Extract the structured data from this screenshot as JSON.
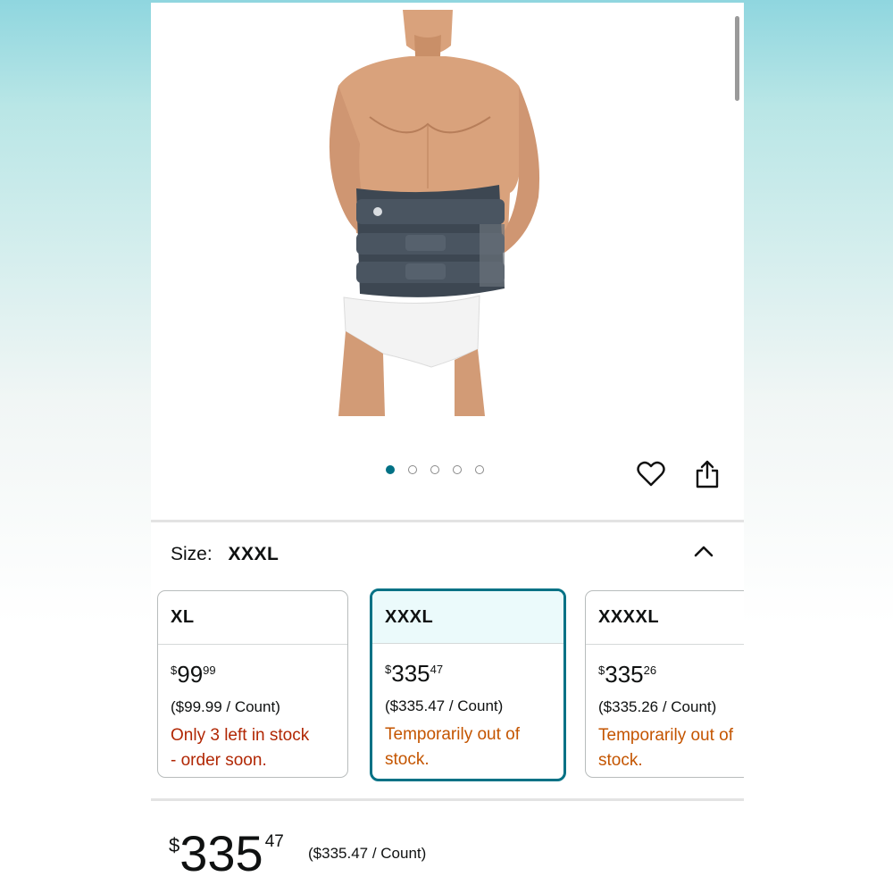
{
  "size": {
    "label": "Size:",
    "selected": "XXXL"
  },
  "carousel": {
    "total": 5,
    "active_index": 0
  },
  "options": [
    {
      "name": "XL",
      "price_symbol": "$",
      "price_whole": "99",
      "price_fraction": "99",
      "unit_price": "($99.99 / Count)",
      "stock_line1": "Only 3 left in stock",
      "stock_line2": "- order soon."
    },
    {
      "name": "XXXL",
      "price_symbol": "$",
      "price_whole": "335",
      "price_fraction": "47",
      "unit_price": "($335.47 / Count)",
      "stock_line1": "Temporarily out of",
      "stock_line2": "stock."
    },
    {
      "name": "XXXXL",
      "price_symbol": "$",
      "price_whole": "335",
      "price_fraction": "26",
      "unit_price": "($335.26 / Count)",
      "stock_line1": "Temporarily out of",
      "stock_line2": "stock."
    }
  ],
  "buybox": {
    "price_symbol": "$",
    "price_whole": "335",
    "price_fraction": "47",
    "unit_price": "($335.47 / Count)"
  },
  "colors": {
    "accent": "#007185",
    "low_stock": "#b12704",
    "out_of_stock": "#c45500"
  },
  "icons": [
    "heart-icon",
    "share-icon",
    "chevron-up-icon"
  ]
}
